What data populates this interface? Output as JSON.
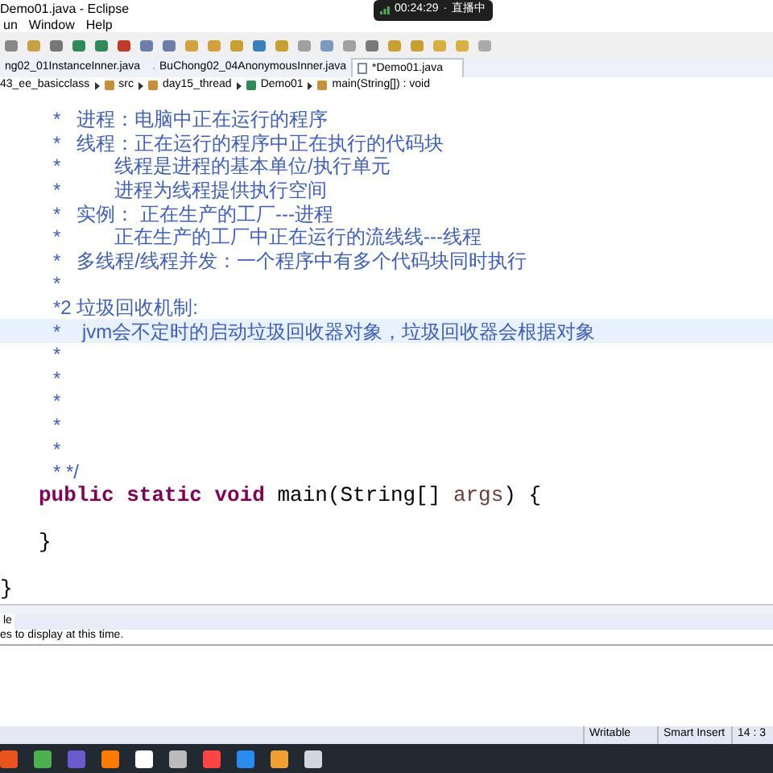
{
  "window": {
    "title": "Demo01.java - Eclipse"
  },
  "recording": {
    "time": "00:24:29",
    "separator": "·",
    "label": "直播中"
  },
  "menu": [
    "un",
    "Window",
    "Help"
  ],
  "editor_tabs": [
    {
      "label": "ng02_01InstanceInner.java",
      "selected": false
    },
    {
      "label": "BuChong02_04AnonymousInner.java",
      "selected": false
    },
    {
      "label": "*Demo01.java",
      "selected": true
    }
  ],
  "breadcrumb": [
    "43_ee_basicclass",
    "src",
    "day15_thread",
    "Demo01",
    "main(String[]) : void"
  ],
  "code": [
    {
      "kind": "comment",
      "text": "*   进程：电脑中正在运行的程序",
      "current": false
    },
    {
      "kind": "comment",
      "text": "*   线程：正在运行的程序中正在执行的代码块",
      "current": false
    },
    {
      "kind": "comment",
      "text": "*          线程是进程的基本单位/执行单元",
      "current": false
    },
    {
      "kind": "comment",
      "text": "*          进程为线程提供执行空间",
      "current": false
    },
    {
      "kind": "comment",
      "text": "*   实例： 正在生产的工厂---进程",
      "current": false
    },
    {
      "kind": "comment",
      "text": "*          正在生产的工厂中正在运行的流线线---线程",
      "current": false
    },
    {
      "kind": "comment",
      "text": "*   多线程/线程并发：一个程序中有多个代码块同时执行",
      "current": false
    },
    {
      "kind": "comment",
      "text": "*",
      "current": false
    },
    {
      "kind": "comment",
      "text": "*2 垃圾回收机制:",
      "current": false
    },
    {
      "kind": "comment",
      "text": "*    jvm会不定时的启动垃圾回收器对象，垃圾回收器会根据对象",
      "current": true
    },
    {
      "kind": "comment",
      "text": "*",
      "current": false
    },
    {
      "kind": "comment",
      "text": "*",
      "current": false
    },
    {
      "kind": "comment",
      "text": "*",
      "current": false
    },
    {
      "kind": "comment",
      "text": "*",
      "current": false
    },
    {
      "kind": "comment",
      "text": "*",
      "current": false
    },
    {
      "kind": "comment",
      "text": "* */",
      "current": false
    },
    {
      "kind": "code",
      "tokens": [
        {
          "text": "public",
          "kind": "keyword"
        },
        {
          "text": "static",
          "kind": "keyword"
        },
        {
          "text": "void",
          "kind": "keyword"
        },
        {
          "text": "main(String[]",
          "kind": "plain"
        },
        {
          "text": "args",
          "kind": "param"
        },
        {
          "text": ") {",
          "kind": "plain"
        }
      ],
      "current": false
    },
    {
      "kind": "blank",
      "current": false
    },
    {
      "kind": "code",
      "tokens": [
        {
          "text": "}",
          "kind": "plain"
        }
      ],
      "current": false
    },
    {
      "kind": "blank",
      "current": false
    },
    {
      "kind": "outer",
      "tokens": [
        {
          "text": "}",
          "kind": "plain"
        }
      ],
      "current": false
    }
  ],
  "bottom_panel": {
    "tab": "le",
    "message": "es to display at this time."
  },
  "status_bar": [
    "Writable",
    "Smart Insert",
    "14 : 3"
  ]
}
